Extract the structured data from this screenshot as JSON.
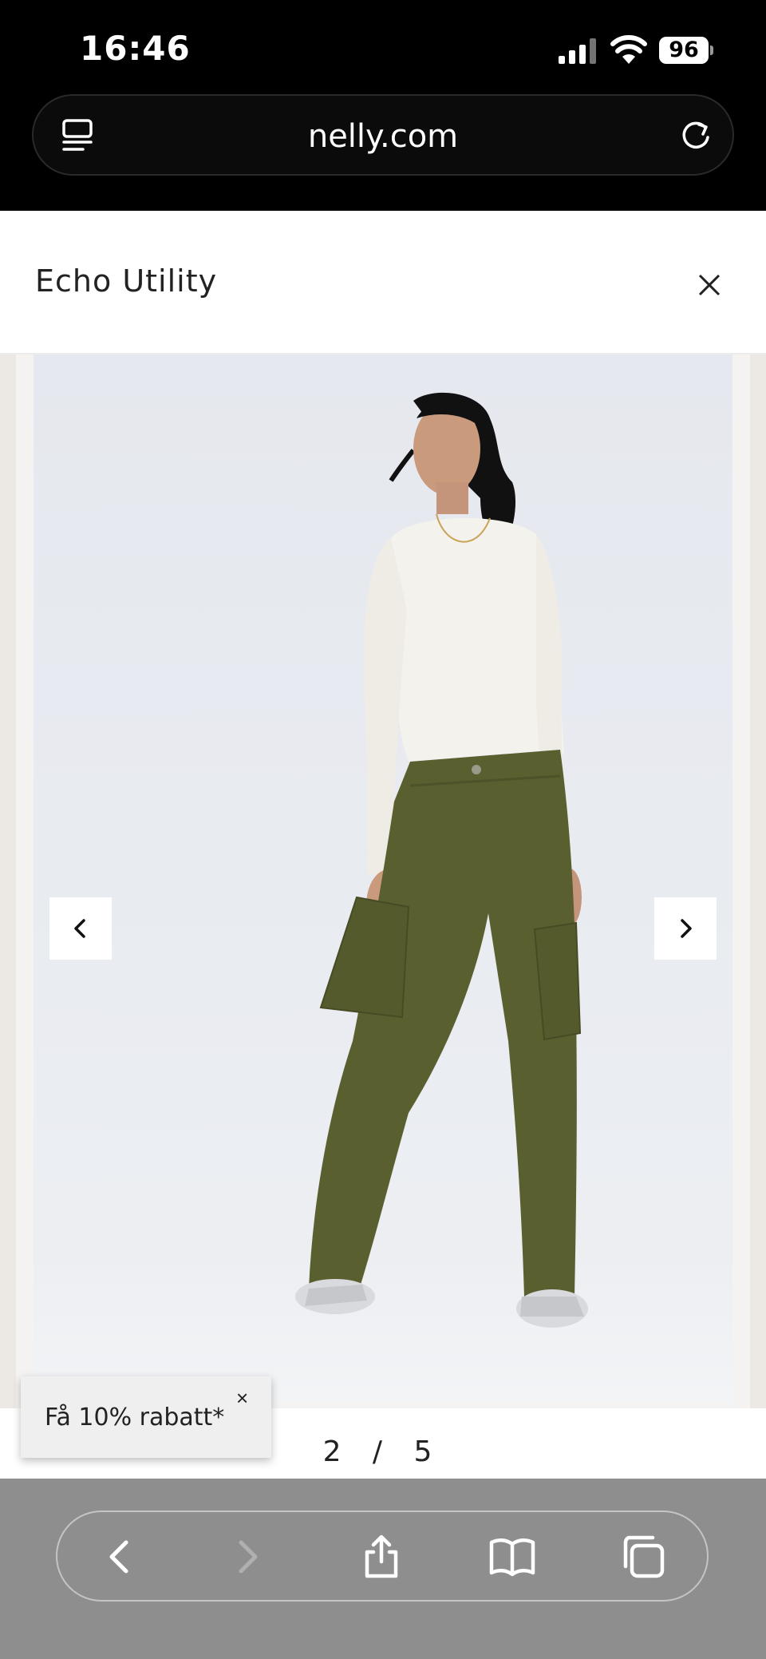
{
  "status_bar": {
    "time": "16:46",
    "battery": "96"
  },
  "browser": {
    "url": "nelly.com"
  },
  "modal": {
    "title": "Echo Utility"
  },
  "gallery": {
    "current": "2",
    "separator": "/",
    "total": "5"
  },
  "promo": {
    "text": "Få 10% rabatt*",
    "close": "×"
  },
  "colors": {
    "pants": "#5a5f30",
    "top": "#f3f1ec",
    "background": "#e7eaef",
    "toolbar": "#8e8e8e"
  }
}
